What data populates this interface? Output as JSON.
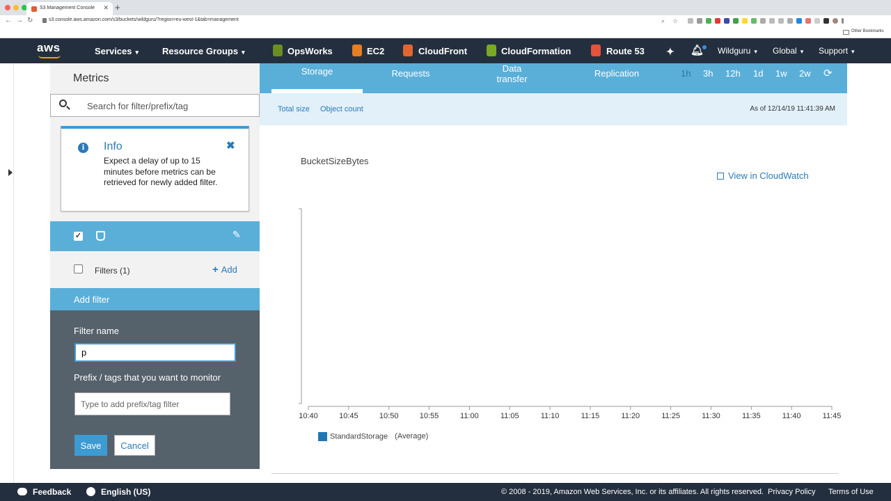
{
  "browser": {
    "tab_title": "S3 Management Console",
    "url": "s3.console.aws.amazon.com/s3/buckets/wildguru/?region=eu-west-1&tab=management",
    "bookmarks_label": "Other Bookmarks"
  },
  "awsnav": {
    "logo": "aws",
    "services": "Services",
    "resource_groups": "Resource Groups",
    "shortcuts": [
      "OpsWorks",
      "EC2",
      "CloudFront",
      "CloudFormation",
      "Route 53"
    ],
    "account": "Wildguru",
    "region": "Global",
    "support": "Support"
  },
  "panel": {
    "title": "Metrics",
    "search_placeholder": "Search for filter/prefix/tag",
    "info": {
      "title": "Info",
      "body": "Expect a delay of up to 15 minutes before metrics can be retrieved for newly added filter."
    },
    "filters_label": "Filters (1)",
    "add_label": "Add",
    "add_filter_header": "Add filter",
    "filter_name_label": "Filter name",
    "filter_name_value": "p",
    "prefix_label": "Prefix / tags that you want to monitor",
    "prefix_placeholder": "Type to add prefix/tag filter",
    "save_label": "Save",
    "cancel_label": "Cancel"
  },
  "main": {
    "tabs": [
      "Storage",
      "Requests",
      "Data transfer",
      "Replication"
    ],
    "ranges": [
      "1h",
      "3h",
      "12h",
      "1d",
      "1w",
      "2w"
    ],
    "selected_range": "1h",
    "sub_links": [
      "Total size",
      "Object count"
    ],
    "as_of": "As of 12/14/19 11:41:39 AM",
    "chart_title": "BucketSizeBytes",
    "cloudwatch_link": "View in CloudWatch"
  },
  "chart_data": {
    "type": "line",
    "title": "BucketSizeBytes",
    "x": [
      "10:40",
      "10:45",
      "10:50",
      "10:55",
      "11:00",
      "11:05",
      "11:10",
      "11:15",
      "11:20",
      "11:25",
      "11:30",
      "11:35",
      "11:40",
      "11:45"
    ],
    "series": [
      {
        "name": "StandardStorage",
        "values": []
      }
    ],
    "legend_suffix": "(Average)",
    "grid": false,
    "colors": {
      "series": "#1f77b4"
    }
  },
  "footer": {
    "feedback": "Feedback",
    "language": "English (US)",
    "copyright": "© 2008 - 2019, Amazon Web Services, Inc. or its affiliates. All rights reserved.",
    "privacy": "Privacy Policy",
    "terms": "Terms of Use"
  },
  "colors": {
    "nav_bg": "#232f3e",
    "accent_blue": "#5aafd9",
    "link_blue": "#2b7ab8",
    "panel_dark": "#55616b",
    "aws_orange": "#ff9900"
  }
}
